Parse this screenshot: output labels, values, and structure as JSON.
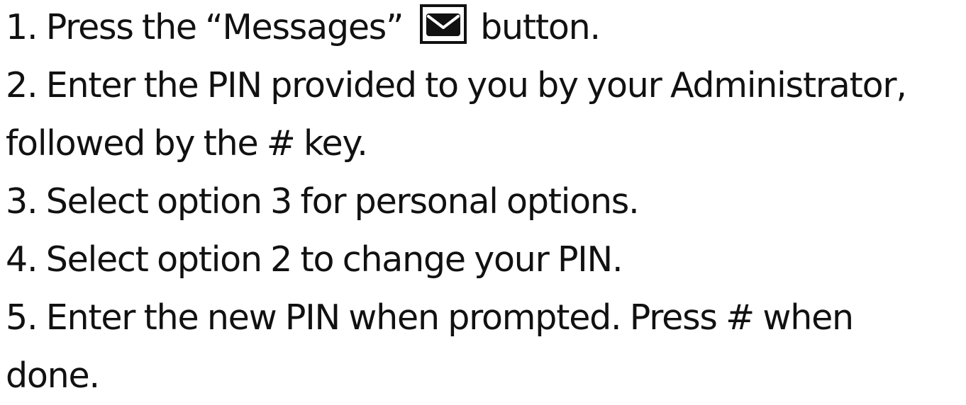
{
  "instructions": {
    "step1_before_icon": "1. Press the “Messages”",
    "messages_icon": "envelope-icon",
    "step1_after_icon": "button.",
    "step2_line1": "2. Enter the PIN provided to you by your Administrator,",
    "step2_line2": "followed by the # key.",
    "step3": "3. Select option 3 for personal options.",
    "step4": "4. Select option 2 to change your PIN.",
    "step5_line1": "5. Enter the new PIN when prompted. Press # when",
    "step5_line2": "done."
  },
  "colors": {
    "text": "#111111",
    "background": "#ffffff"
  }
}
